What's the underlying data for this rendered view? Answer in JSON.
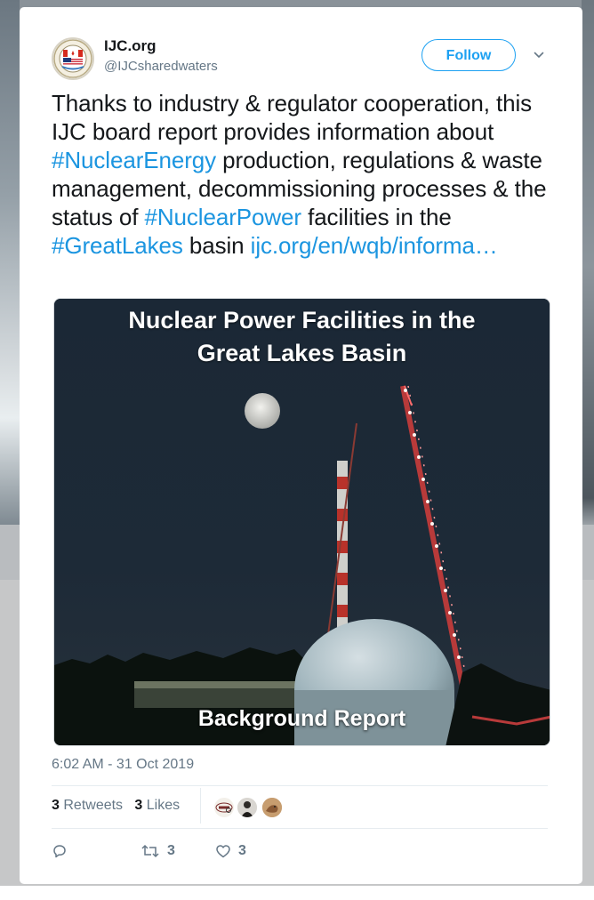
{
  "tweet": {
    "author_name": "IJC.org",
    "author_handle": "@IJCsharedwaters",
    "follow_label": "Follow",
    "text_parts": [
      {
        "kind": "text",
        "value": "Thanks to industry & regulator cooperation, this IJC board report provides information about "
      },
      {
        "kind": "tag",
        "value": "#NuclearEnergy"
      },
      {
        "kind": "text",
        "value": " production, regulations & waste management, decommissioning processes & the status of "
      },
      {
        "kind": "tag",
        "value": "#NuclearPower"
      },
      {
        "kind": "text",
        "value": " facilities in the "
      },
      {
        "kind": "tag",
        "value": "#GreatLakes"
      },
      {
        "kind": "text",
        "value": " basin "
      },
      {
        "kind": "link",
        "value": "ijc.org/en/wqb/informa…"
      }
    ],
    "media": {
      "title_line1": "Nuclear Power Facilities in the",
      "title_line2": "Great Lakes Basin",
      "subtitle": "Background Report"
    },
    "timestamp": "6:02 AM - 31 Oct 2019",
    "stats": {
      "retweets_count": "3",
      "retweets_label": "Retweets",
      "likes_count": "3",
      "likes_label": "Likes"
    },
    "actions": {
      "reply_count": "",
      "retweet_count": "3",
      "like_count": "3"
    },
    "liker_avatars": [
      {
        "name": "news-avatar-icon"
      },
      {
        "name": "person-avatar-icon"
      },
      {
        "name": "animal-avatar-icon"
      }
    ]
  },
  "colors": {
    "accent": "#1da1f2",
    "link": "#1b95e0",
    "text": "#14171a",
    "muted": "#657786"
  }
}
